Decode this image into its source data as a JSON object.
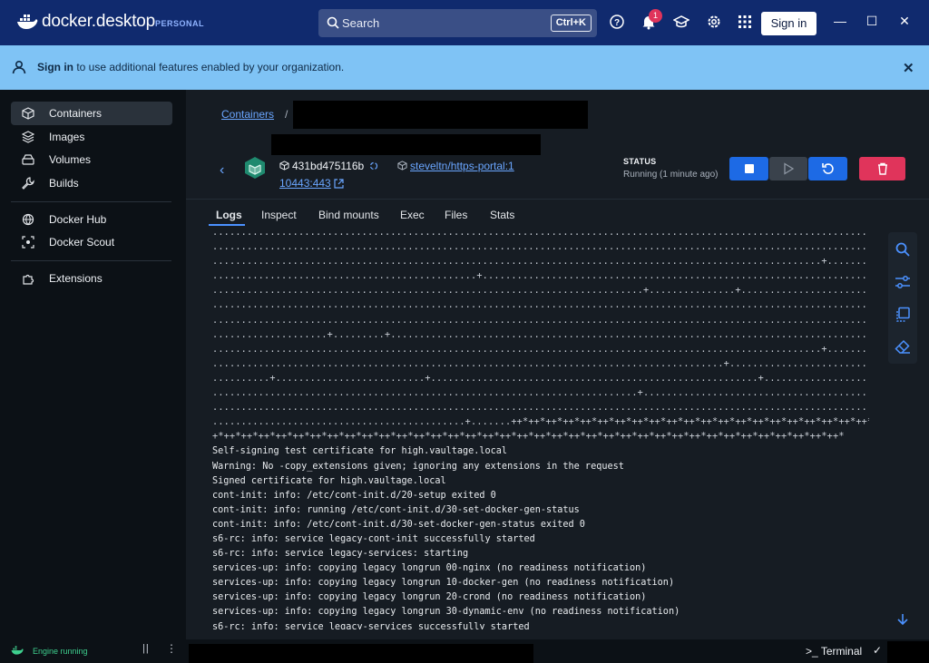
{
  "titlebar": {
    "app_name": "docker.desktop",
    "plan_badge": "PERSONAL",
    "search_placeholder": "Search",
    "search_shortcut": "Ctrl+K",
    "notification_count": "1",
    "sign_in_label": "Sign in",
    "icons": [
      "help-icon",
      "bell-icon",
      "learning-icon",
      "gear-icon",
      "grid-icon"
    ],
    "window_controls": [
      "minimize",
      "maximize",
      "close"
    ]
  },
  "banner": {
    "strong": "Sign in",
    "text": " to use additional features enabled by your organization."
  },
  "sidebar": {
    "items": [
      {
        "label": "Containers",
        "icon": "containers-icon",
        "active": true
      },
      {
        "label": "Images",
        "icon": "images-icon"
      },
      {
        "label": "Volumes",
        "icon": "volumes-icon"
      },
      {
        "label": "Builds",
        "icon": "builds-icon"
      },
      {
        "label": "Docker Hub",
        "icon": "hub-icon"
      },
      {
        "label": "Docker Scout",
        "icon": "scout-icon"
      },
      {
        "label": "Extensions",
        "icon": "extensions-icon"
      }
    ],
    "engine_status": "Engine running"
  },
  "container": {
    "breadcrumb_root": "Containers",
    "breadcrumb_sep": "/",
    "id": "431bd475116b",
    "image": "steveltn/https-portal:1",
    "port": "10443:443",
    "status_label": "STATUS",
    "status_value": "Running (1 minute ago)"
  },
  "tabs": [
    "Logs",
    "Inspect",
    "Bind mounts",
    "Exec",
    "Files",
    "Stats"
  ],
  "active_tab": "Logs",
  "log_lines": [
    "........................................................................................................................",
    "........................................................................................................................",
    "..........................................................................................................+.............",
    "..............................................+.........................................................................",
    "...........................................................................+...............+............................",
    "........................................................................................................................",
    "........................................................................................................................",
    "....................+.........+.........................................................................................",
    "..........................................................................................................+.............",
    ".........................................................................................+..............................",
    "..........+..........................+.........................................................+........................",
    "..........................................................................+.............................................",
    "........................................................................................................................",
    "............................................+.......++*++*++*++*++*++*++*++*++*++*++*++*++*++*++*++*++*++*++*++*++*++*+",
    "+*++*++*++*++*++*++*++*++*++*++*++*++*++*++*++*++*++*++*++*++*++*++*++*++*++*++*++*++*++*++*++*++*++*++*++*++*",
    "Self-signing test certificate for high.vaultage.local",
    "Warning: No -copy_extensions given; ignoring any extensions in the request",
    "Signed certificate for high.vaultage.local",
    "cont-init: info: /etc/cont-init.d/20-setup exited 0",
    "cont-init: info: running /etc/cont-init.d/30-set-docker-gen-status",
    "cont-init: info: /etc/cont-init.d/30-set-docker-gen-status exited 0",
    "s6-rc: info: service legacy-cont-init successfully started",
    "s6-rc: info: service legacy-services: starting",
    "services-up: info: copying legacy longrun 00-nginx (no readiness notification)",
    "services-up: info: copying legacy longrun 10-docker-gen (no readiness notification)",
    "services-up: info: copying legacy longrun 20-crond (no readiness notification)",
    "services-up: info: copying legacy longrun 30-dynamic-env (no readiness notification)",
    "s6-rc: info: service legacy-services successfully started"
  ],
  "footer": {
    "terminal_label": "Terminal"
  },
  "colors": {
    "titlebar": "#102a6e",
    "banner": "#7fc3f5",
    "accent": "#4b91ff",
    "stop_button": "#1d6ae5",
    "delete_button": "#e0345b",
    "engine_green": "#3ecf8e"
  }
}
